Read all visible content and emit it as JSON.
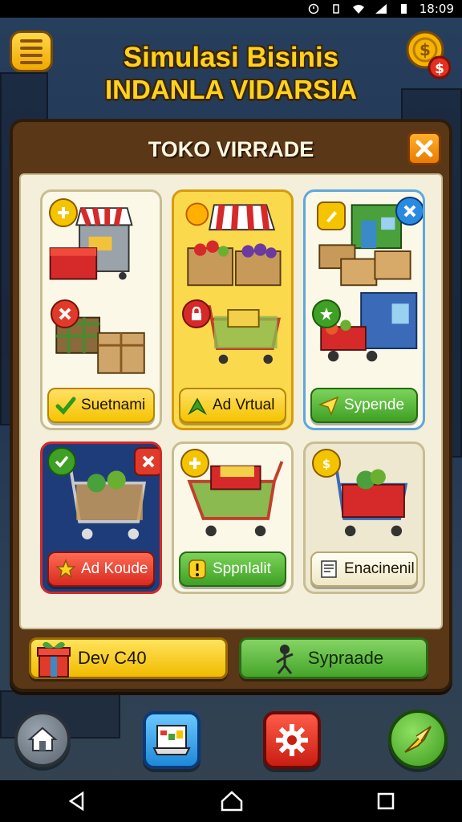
{
  "status_bar": {
    "time": "18:09"
  },
  "header": {
    "title_line1": "Simulasi Bisinis",
    "title_line2": "INDANLA VIDARSIA"
  },
  "panel": {
    "title": "TOKO VIRRADE"
  },
  "cards": [
    {
      "label": "Suetnami",
      "style": "yellow",
      "icon": "check-icon"
    },
    {
      "label": "Ad Vrtual",
      "style": "yellow",
      "icon": "arrow-up-icon"
    },
    {
      "label": "Sypende",
      "style": "green",
      "icon": "paper-plane-icon"
    },
    {
      "label": "Ad Koude",
      "style": "red",
      "icon": "star-icon"
    },
    {
      "label": "Sppnlalit",
      "style": "green",
      "icon": "exclamation-icon"
    },
    {
      "label": "Enacinenil",
      "style": "white",
      "icon": "document-icon"
    }
  ],
  "footer": {
    "left_label": "Dev C40",
    "right_label": "Sypraade"
  },
  "bottom_bar": [
    "home-icon",
    "tablet-icon",
    "gear-icon",
    "send-icon"
  ],
  "colors": {
    "gold": "#ffd21f",
    "panel": "#5a3717",
    "green": "#45a52a",
    "red": "#d82a1e"
  }
}
